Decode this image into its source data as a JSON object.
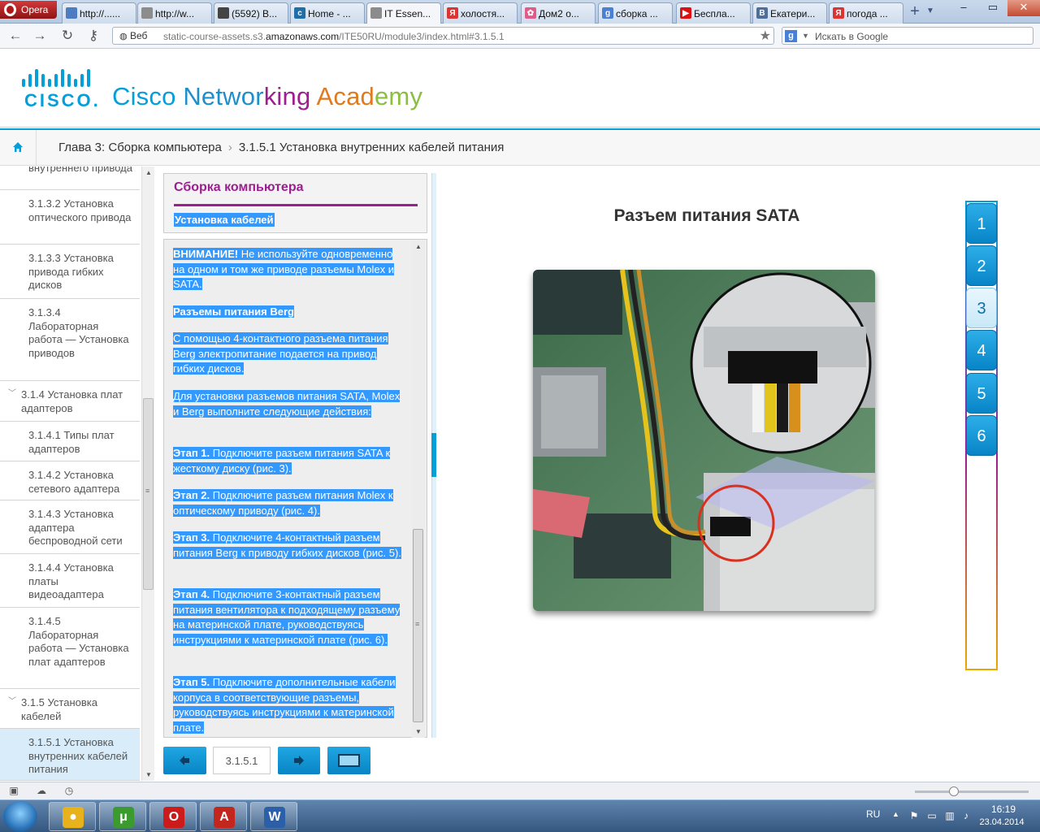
{
  "browser": {
    "menu_label": "Opera",
    "tabs": [
      {
        "label": "http://......",
        "icon": "globe-icon",
        "color": "#4d7cc1",
        "glyph": ""
      },
      {
        "label": "http://w...",
        "icon": "page-icon",
        "color": "#8c8c8c",
        "glyph": ""
      },
      {
        "label": "(5592) В...",
        "icon": "mail-icon",
        "color": "#444444",
        "glyph": ""
      },
      {
        "label": "Home - ...",
        "icon": "cisco-icon",
        "color": "#1e6fa9",
        "glyph": "c"
      },
      {
        "label": "IT Essen...",
        "icon": "page-icon",
        "color": "#8c8c8c",
        "glyph": "",
        "active": true
      },
      {
        "label": "холостя...",
        "icon": "yandex-icon",
        "color": "#d33",
        "glyph": "Я"
      },
      {
        "label": "Дом2 о...",
        "icon": "flower-icon",
        "color": "#e05a8a",
        "glyph": "✿"
      },
      {
        "label": "сборка ...",
        "icon": "google-icon",
        "color": "#4a7fd6",
        "glyph": "g"
      },
      {
        "label": "Беспла...",
        "icon": "youtube-icon",
        "color": "#d11",
        "glyph": "▶"
      },
      {
        "label": "Екатери...",
        "icon": "vk-icon",
        "color": "#4d6f99",
        "glyph": "B"
      },
      {
        "label": "погода ...",
        "icon": "yandex-icon",
        "color": "#d33",
        "glyph": "Я"
      }
    ],
    "web_label": "Веб",
    "url_prefix": "static-course-assets.s3.",
    "url_host": "amazonaws.com",
    "url_suffix": "/ITE50RU/module3/index.html#3.1.5.1",
    "search_placeholder": "Искать в Google"
  },
  "header": {
    "cisco_word": "CISCO.",
    "academy_parts": [
      {
        "text": "Cisco ",
        "color": "#049fd9"
      },
      {
        "text": "Networ",
        "color": "#1f8fc9"
      },
      {
        "text": "king ",
        "color": "#9b1f8f"
      },
      {
        "text": "Acad",
        "color": "#e07a1f"
      },
      {
        "text": "emy",
        "color": "#8cbf3f"
      }
    ]
  },
  "breadcrumb": {
    "chapter": "Глава 3: Сборка компьютера",
    "section": "3.1.5.1 Установка внутренних кабелей питания"
  },
  "toc": {
    "items": [
      {
        "text": "внутреннего привода",
        "level": 2
      },
      {
        "text": "3.1.3.2 Установка оптического привода",
        "level": 2
      },
      {
        "text": "3.1.3.3 Установка привода гибких дисков",
        "level": 2
      },
      {
        "text": "3.1.3.4 Лабораторная работа — Установка приводов",
        "level": 2
      },
      {
        "text": "3.1.4 Установка плат адаптеров",
        "level": 1
      },
      {
        "text": "3.1.4.1 Типы плат адаптеров",
        "level": 2
      },
      {
        "text": "3.1.4.2 Установка сетевого адаптера",
        "level": 2
      },
      {
        "text": "3.1.4.3 Установка адаптера беспроводной сети",
        "level": 2
      },
      {
        "text": "3.1.4.4 Установка платы видеоадаптера",
        "level": 2
      },
      {
        "text": "3.1.4.5 Лабораторная работа — Установка плат адаптеров",
        "level": 2
      },
      {
        "text": "3.1.5 Установка кабелей",
        "level": 1
      },
      {
        "text": "3.1.5.1 Установка внутренних кабелей питания",
        "level": 2,
        "active": true
      }
    ]
  },
  "panel": {
    "title": "Сборка компьютера",
    "subtitle": "Установка кабелей",
    "paragraphs": [
      {
        "bold": "ВНИМАНИЕ!",
        "text": " Не используйте одновременно на одном и том же приводе разъемы Molex и SATA."
      },
      {
        "bold": "Разъемы питания Berg",
        "text": ""
      },
      {
        "bold": "",
        "text": "С помощью 4-контактного разъема питания Berg электропитание подается на привод гибких дисков."
      },
      {
        "bold": "",
        "text": "Для установки разъемов питания SATA, Molex и Berg выполните следующие действия:"
      },
      {
        "bold": "Этап 1.",
        "text": " Подключите разъем питания SATA к жесткому диску (рис. 3)."
      },
      {
        "bold": "Этап 2.",
        "text": " Подключите разъем питания Molex к оптическому приводу (рис. 4)."
      },
      {
        "bold": "Этап 3.",
        "text": " Подключите 4-контактный разъем питания Berg к приводу гибких дисков (рис. 5)."
      },
      {
        "bold": "Этап 4.",
        "text": " Подключите 3-контактный разъем питания вентилятора к подходящему разъему на материнской плате, руководствуясь инструкциями к материнской плате (рис. 6)."
      },
      {
        "bold": "Этап 5.",
        "text": " Подключите дополнительные кабели корпуса в соответствующие разъемы, руководствуясь инструкциями к материнской плате."
      }
    ]
  },
  "nav": {
    "page": "3.1.5.1"
  },
  "figure": {
    "title": "Разъем питания SATA"
  },
  "steps": {
    "labels": [
      "1",
      "2",
      "3",
      "4",
      "5",
      "6"
    ],
    "active_index": 2
  },
  "taskbar": {
    "apps": [
      {
        "name": "chrome-icon",
        "color": "#e8b21c",
        "glyph": "●"
      },
      {
        "name": "utorrent-icon",
        "color": "#3b9b2e",
        "glyph": "μ"
      },
      {
        "name": "opera-icon",
        "color": "#cc1b1b",
        "glyph": "O"
      },
      {
        "name": "acrobat-icon",
        "color": "#c2261d",
        "glyph": "A"
      },
      {
        "name": "word-icon",
        "color": "#2b5fa8",
        "glyph": "W"
      }
    ],
    "lang": "RU",
    "time": "16:19",
    "date": "23.04.2014"
  }
}
